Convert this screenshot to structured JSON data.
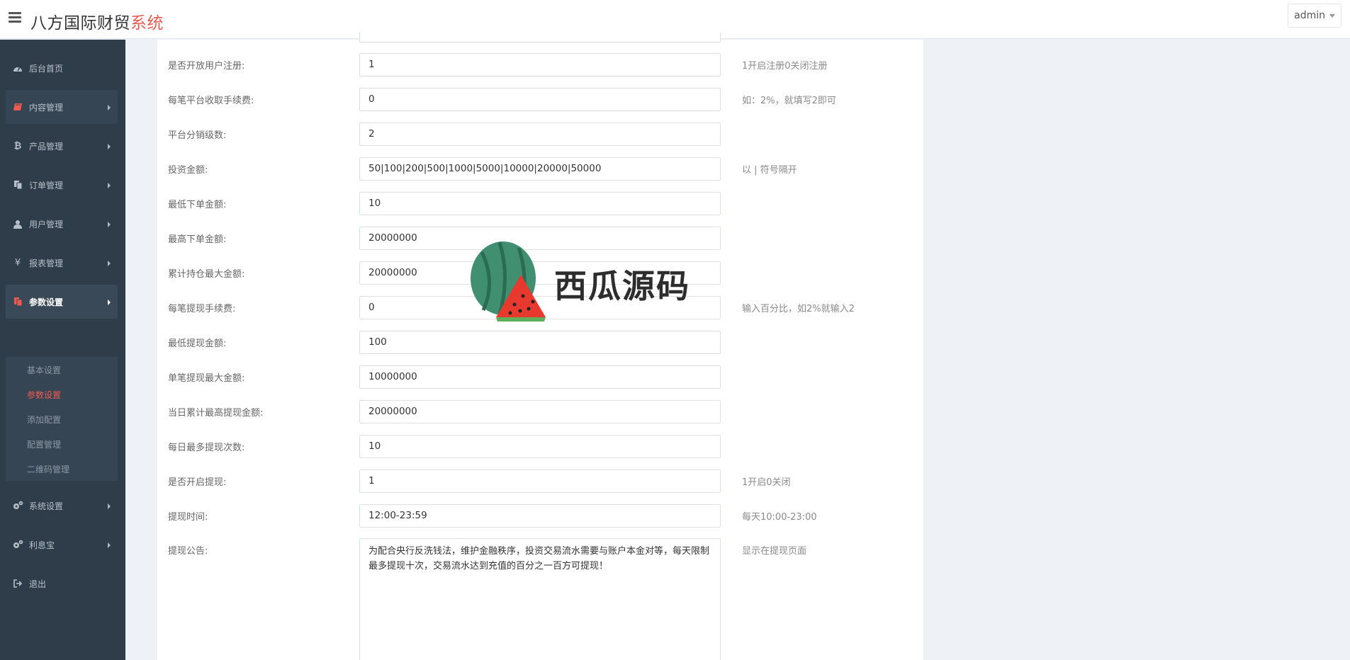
{
  "header": {
    "brand_main": "八方国际财贸",
    "brand_accent": "系统",
    "user": "admin"
  },
  "sidebar": {
    "items": [
      {
        "label": "后台首页",
        "icon": "dashboard-icon"
      },
      {
        "label": "内容管理",
        "icon": "book-icon"
      },
      {
        "label": "产品管理",
        "icon": "bitcoin-icon"
      },
      {
        "label": "订单管理",
        "icon": "copy-icon"
      },
      {
        "label": "用户管理",
        "icon": "user-icon"
      },
      {
        "label": "报表管理",
        "icon": "yen-icon"
      },
      {
        "label": "参数设置",
        "icon": "files-icon"
      },
      {
        "label": "系统设置",
        "icon": "gears-icon"
      },
      {
        "label": "利息宝",
        "icon": "gears-icon"
      },
      {
        "label": "退出",
        "icon": "sign-out-icon"
      }
    ],
    "submenu": [
      {
        "label": "基本设置"
      },
      {
        "label": "参数设置"
      },
      {
        "label": "添加配置"
      },
      {
        "label": "配置管理"
      },
      {
        "label": "二维码管理"
      }
    ]
  },
  "form": {
    "rows": [
      {
        "label": "是否开放用户注册:",
        "value": "1",
        "hint": "1开启注册0关闭注册"
      },
      {
        "label": "每笔平台收取手续费:",
        "value": "0",
        "hint": "如：2%，就填写2即可"
      },
      {
        "label": "平台分销级数:",
        "value": "2",
        "hint": ""
      },
      {
        "label": "投资金额:",
        "value": "50|100|200|500|1000|5000|10000|20000|50000",
        "hint": "以 | 符号隔开"
      },
      {
        "label": "最低下单金额:",
        "value": "10",
        "hint": ""
      },
      {
        "label": "最高下单金额:",
        "value": "20000000",
        "hint": ""
      },
      {
        "label": "累计持仓最大金额:",
        "value": "20000000",
        "hint": ""
      },
      {
        "label": "每笔提现手续费:",
        "value": "0",
        "hint": "输入百分比，如2%就输入2"
      },
      {
        "label": "最低提现金额:",
        "value": "100",
        "hint": ""
      },
      {
        "label": "单笔提现最大金额:",
        "value": "10000000",
        "hint": ""
      },
      {
        "label": "当日累计最高提现金额:",
        "value": "20000000",
        "hint": ""
      },
      {
        "label": "每日最多提现次数:",
        "value": "10",
        "hint": ""
      },
      {
        "label": "是否开启提现:",
        "value": "1",
        "hint": "1开启0关闭"
      },
      {
        "label": "提现时间:",
        "value": "12:00-23:59",
        "hint": "每天10:00-23:00"
      }
    ],
    "notice": {
      "label": "提现公告:",
      "value": "为配合央行反洗钱法，维护金融秩序，投资交易流水需要与账户本金对等，每天限制最多提现十次，交易流水达到充值的百分之一百方可提现！",
      "hint": "显示在提现页面"
    }
  },
  "watermark": {
    "text": "西瓜源码"
  },
  "colors": {
    "accent": "#ec5a4f",
    "sidebar": "#2f3d4b"
  }
}
